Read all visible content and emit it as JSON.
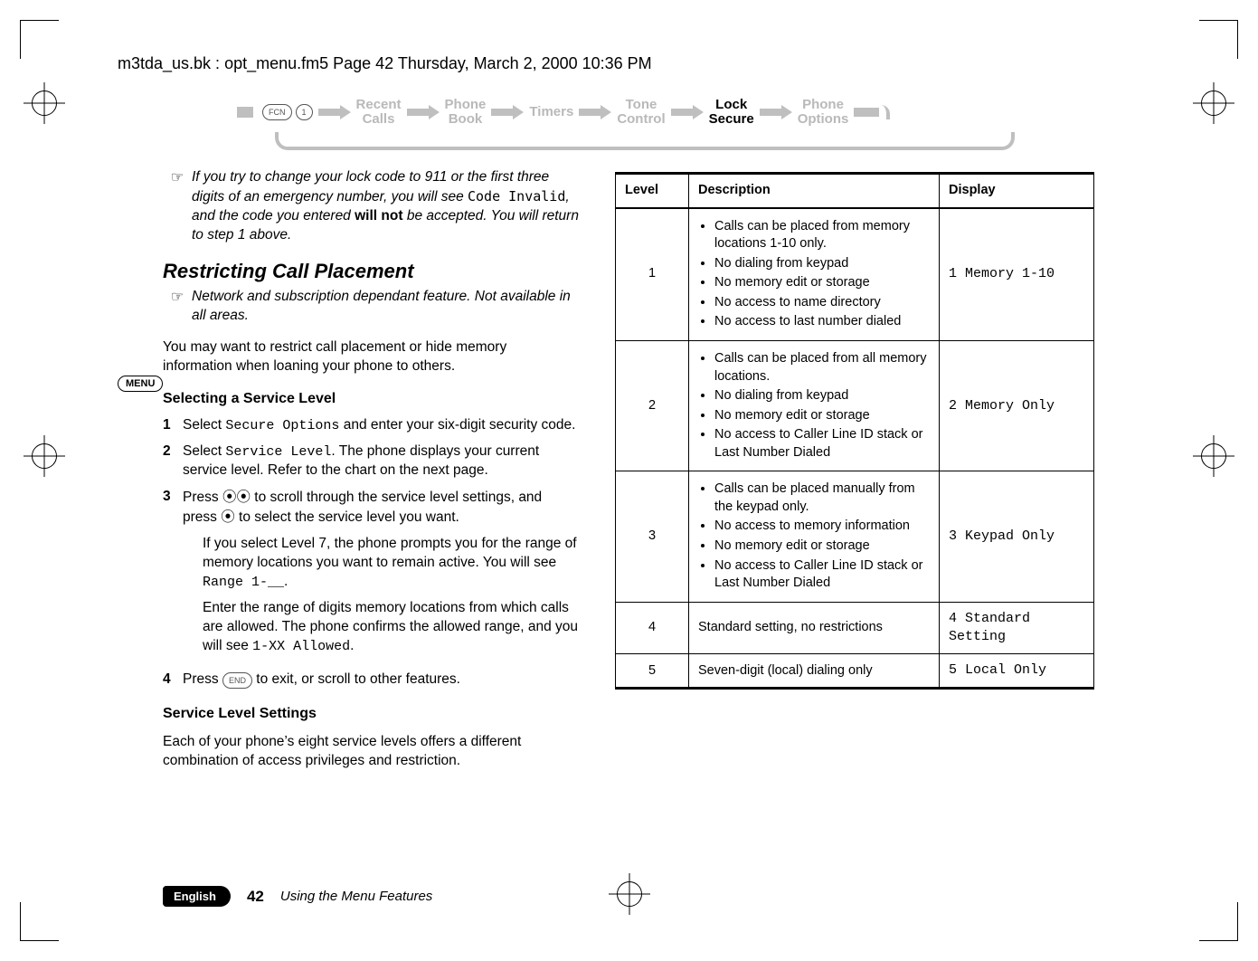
{
  "header": {
    "line": "m3tda_us.bk : opt_menu.fm5  Page 42  Thursday, March 2, 2000  10:36 PM"
  },
  "nav": {
    "key1": "FCN",
    "key2": "1",
    "items": [
      {
        "l1": "Recent",
        "l2": "Calls",
        "active": false
      },
      {
        "l1": "Phone",
        "l2": "Book",
        "active": false
      },
      {
        "l1": "Timers",
        "l2": "",
        "active": false
      },
      {
        "l1": "Tone",
        "l2": "Control",
        "active": false
      },
      {
        "l1": "Lock",
        "l2": "Secure",
        "active": true
      },
      {
        "l1": "Phone",
        "l2": "Options",
        "active": false
      }
    ]
  },
  "note1": {
    "text_pre": "If you try to change your lock code to 911 or the first three digits of an emergency number, you will see ",
    "code": "Code Invalid",
    "text_mid": ", and the code you entered ",
    "bold": "will not",
    "text_post": " be accepted. You will return to step 1 above."
  },
  "section_title": "Restricting Call Placement",
  "note2": {
    "text": "Network and subscription dependant feature. Not available in all areas."
  },
  "para1": "You may want to restrict call placement or hide memory information when loaning your phone to others.",
  "menu_badge": "MENU",
  "sub1": "Selecting a Service Level",
  "steps": [
    {
      "n": "1",
      "pre": "Select ",
      "code": "Secure Options",
      "post": " and enter your six-digit security code."
    },
    {
      "n": "2",
      "pre": "Select ",
      "code": "Service Level",
      "post": ". The phone displays your current service level. Refer to the chart on the next page."
    },
    {
      "n": "3",
      "pre": "Press ",
      "keys": "qZ",
      "mid": " to scroll through the service level settings, and press ",
      "key2": "a",
      "post": " to select the service level you want."
    },
    {
      "n": "4",
      "pre": "Press ",
      "endkey": "END",
      "post": " to exit, or scroll to other features."
    }
  ],
  "step3_extra1_pre": "If you select Level 7, the phone prompts you for the range of memory locations you want to remain active. You will see ",
  "step3_extra1_code": "Range 1-__",
  "step3_extra1_post": ".",
  "step3_extra2_pre": "Enter the range of digits memory locations from which calls are allowed. The phone confirms the allowed range, and you will see ",
  "step3_extra2_code": "1-XX Allowed",
  "step3_extra2_post": ".",
  "sub2": "Service Level Settings",
  "para2": "Each of your phone’s eight service levels offers a different combination of access privileges and restriction.",
  "table": {
    "head": {
      "level": "Level",
      "desc": "Description",
      "disp": "Display"
    },
    "rows": [
      {
        "level": "1",
        "bullets": [
          "Calls can be placed from memory locations 1-10 only.",
          "No dialing from keypad",
          "No memory edit or storage",
          "No access to name directory",
          "No access to last number dialed"
        ],
        "disp": "1 Memory 1-10"
      },
      {
        "level": "2",
        "bullets": [
          "Calls can be placed from all memory locations.",
          "No dialing from keypad",
          "No memory edit or storage",
          "No access to Caller Line ID stack or Last Number Dialed"
        ],
        "disp": "2 Memory Only"
      },
      {
        "level": "3",
        "bullets": [
          "Calls can be placed manually from the keypad only.",
          "No access to memory information",
          "No memory edit or storage",
          "No access to Caller Line ID stack or Last Number Dialed"
        ],
        "disp": "3 Keypad Only"
      },
      {
        "level": "4",
        "bullets_text": "Standard setting, no restrictions",
        "disp": "4 Standard\nSetting"
      },
      {
        "level": "5",
        "bullets_text": "Seven-digit (local) dialing only",
        "disp": "5 Local Only"
      }
    ]
  },
  "footer": {
    "lang": "English",
    "page": "42",
    "title": "Using the Menu Features"
  },
  "icons": {
    "note_glyph": "☞"
  }
}
